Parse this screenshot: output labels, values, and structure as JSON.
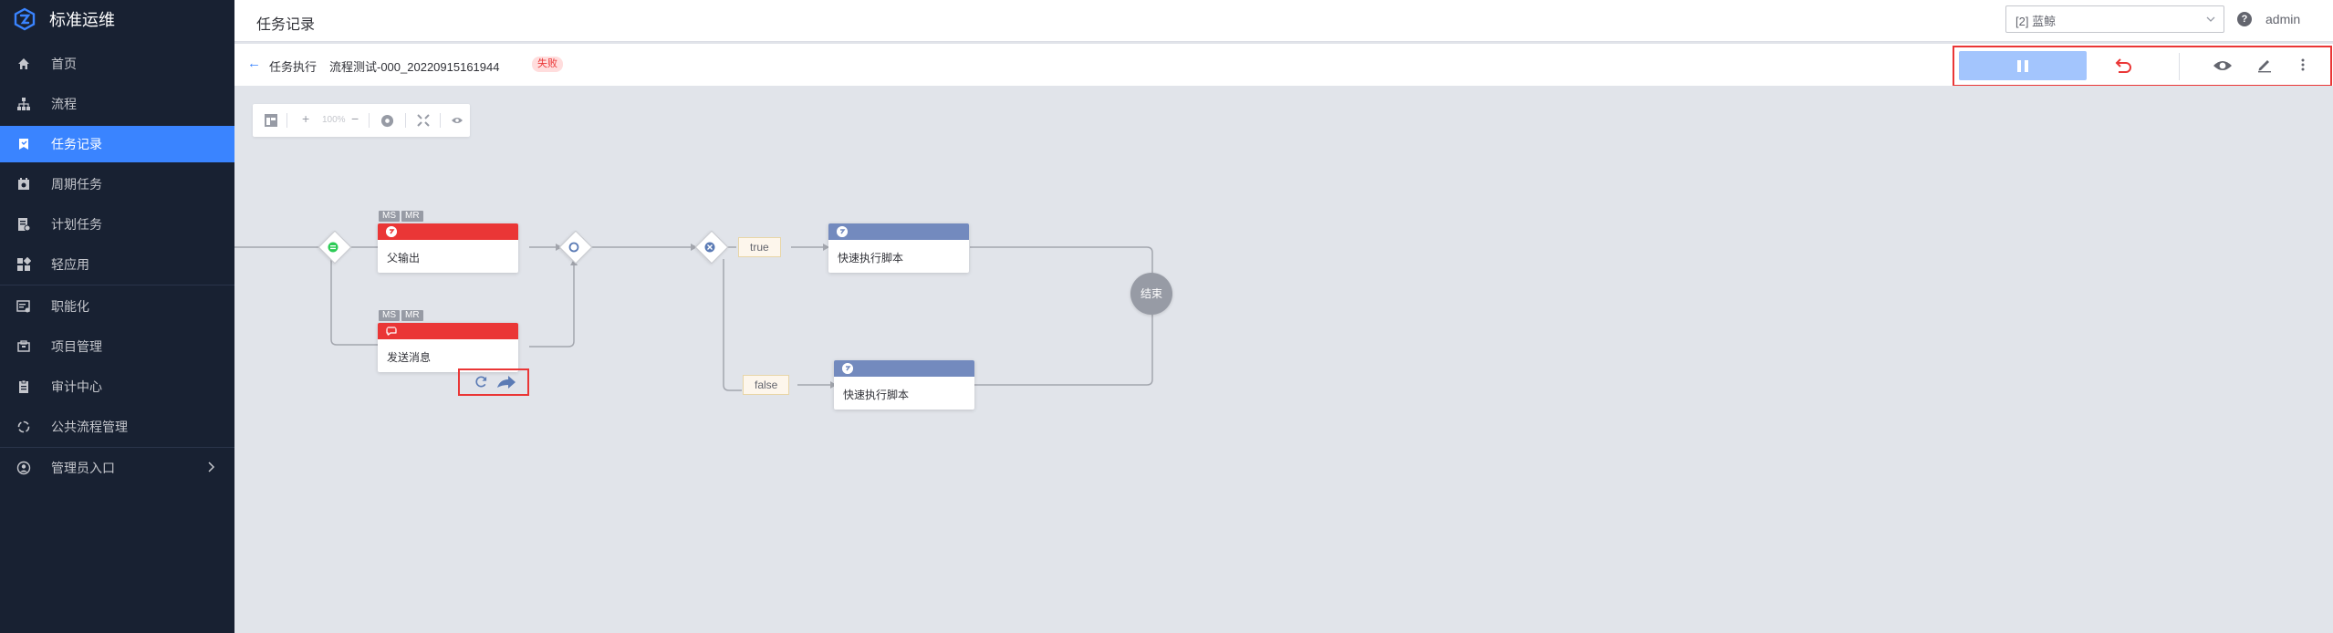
{
  "app": {
    "name": "标准运维"
  },
  "sidebar": {
    "items": [
      {
        "label": "首页",
        "icon": "home-icon"
      },
      {
        "label": "流程",
        "icon": "flow-icon"
      },
      {
        "label": "任务记录",
        "icon": "task-record-icon",
        "active": true
      },
      {
        "label": "周期任务",
        "icon": "periodic-task-icon"
      },
      {
        "label": "计划任务",
        "icon": "plan-task-icon"
      },
      {
        "label": "轻应用",
        "icon": "light-app-icon"
      },
      {
        "label": "职能化",
        "icon": "function-icon"
      },
      {
        "label": "项目管理",
        "icon": "project-icon"
      },
      {
        "label": "审计中心",
        "icon": "audit-icon"
      },
      {
        "label": "公共流程管理",
        "icon": "common-flow-icon"
      },
      {
        "label": "管理员入口",
        "icon": "admin-icon"
      }
    ]
  },
  "header": {
    "title": "任务记录",
    "project": "[2] 蓝鲸",
    "user": "admin",
    "help_glyph": "?"
  },
  "subheader": {
    "back_glyph": "←",
    "label": "任务执行",
    "task_name": "流程测试-000_20220915161944",
    "status": "失败"
  },
  "toolbar": {
    "zoom": "100%",
    "zoom_in": "+",
    "zoom_out": "−"
  },
  "canvas": {
    "nodes": [
      {
        "id": "n1",
        "name": "父输出",
        "state": "failed",
        "tags": [
          "MS",
          "MR"
        ]
      },
      {
        "id": "n2",
        "name": "发送消息",
        "state": "failed",
        "tags": [
          "MS",
          "MR"
        ]
      },
      {
        "id": "n3",
        "name": "快速执行脚本",
        "state": "pending"
      },
      {
        "id": "n4",
        "name": "快速执行脚本",
        "state": "pending"
      }
    ],
    "conditions": {
      "true_label": "true",
      "false_label": "false"
    },
    "end_label": "结束"
  },
  "colors": {
    "sidebar_bg": "#182132",
    "accent": "#3a84ff",
    "failed": "#ea3636",
    "pending": "#738abe",
    "highlight_box": "#ea3636"
  }
}
